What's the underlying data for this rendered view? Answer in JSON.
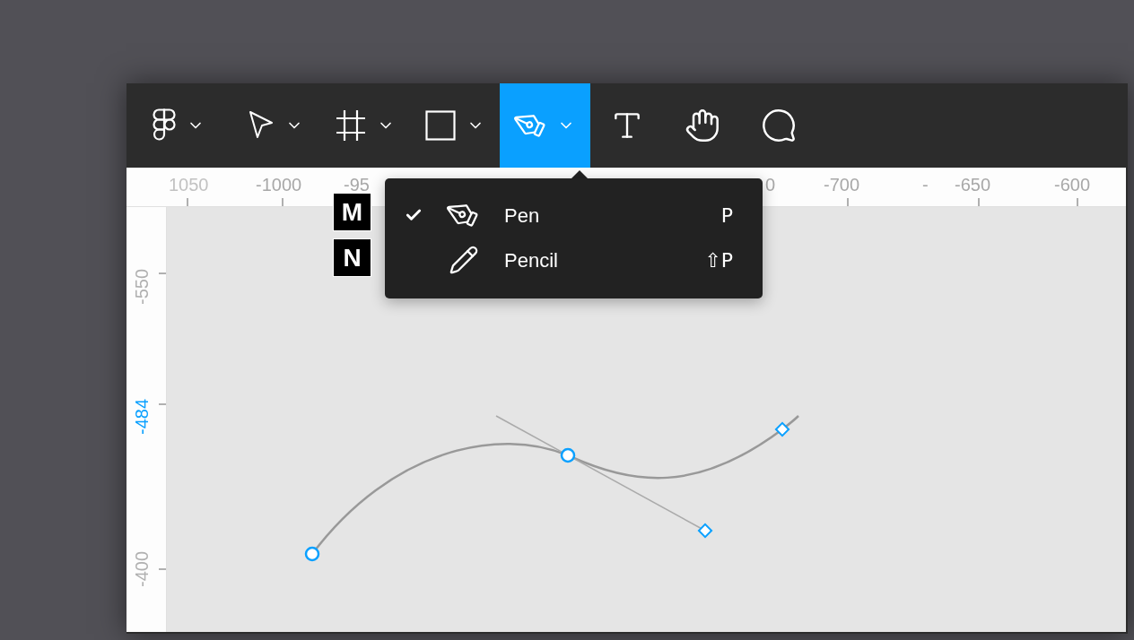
{
  "toolbar": {
    "tools": [
      {
        "kind": "figma",
        "selected": false,
        "menu": true
      },
      {
        "kind": "move",
        "selected": false,
        "menu": true
      },
      {
        "kind": "frame",
        "selected": false,
        "menu": true
      },
      {
        "kind": "rectangle",
        "selected": false,
        "menu": true
      },
      {
        "kind": "pen",
        "selected": true,
        "menu": true
      },
      {
        "kind": "text",
        "selected": false,
        "menu": false
      },
      {
        "kind": "hand",
        "selected": false,
        "menu": false
      },
      {
        "kind": "comment",
        "selected": false,
        "menu": false
      }
    ]
  },
  "rulers": {
    "top": [
      {
        "label": "1050",
        "faded": true
      },
      {
        "label": "-1000",
        "faded": false
      },
      {
        "label": "-95",
        "faded": false
      },
      {
        "label": "0",
        "faded": false
      },
      {
        "label": "-700",
        "faded": false
      },
      {
        "label": "-",
        "faded": false
      },
      {
        "label": "-650",
        "faded": false
      },
      {
        "label": "-600",
        "faded": false
      }
    ],
    "left": [
      {
        "label": "-550",
        "highlighted": false
      },
      {
        "label": "-484",
        "highlighted": true
      },
      {
        "label": "-400",
        "highlighted": false
      }
    ]
  },
  "key_hints": [
    "M",
    "N"
  ],
  "menu": {
    "items": [
      {
        "label": "Pen",
        "shortcut": "P",
        "checked": true
      },
      {
        "label": "Pencil",
        "shortcut": "⇧P",
        "checked": false
      }
    ]
  }
}
